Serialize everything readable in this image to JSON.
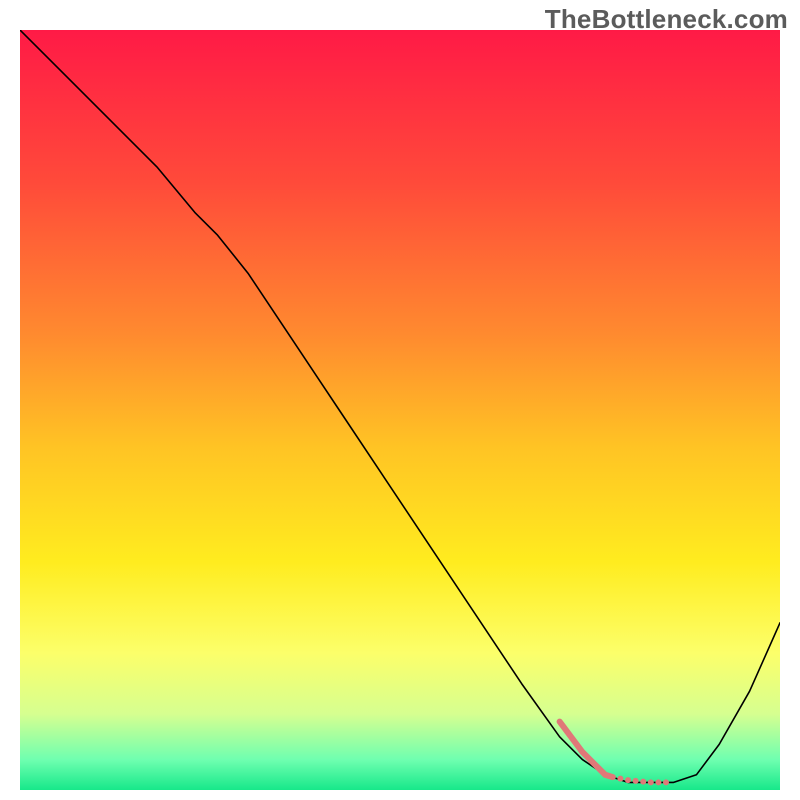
{
  "watermark": "TheBottleneck.com",
  "chart_data": {
    "type": "line",
    "title": "",
    "xlabel": "",
    "ylabel": "",
    "xlim": [
      0,
      100
    ],
    "ylim": [
      0,
      100
    ],
    "grid": false,
    "legend": false,
    "background": {
      "type": "vertical-gradient",
      "stops": [
        {
          "pos": 0.0,
          "color": "#ff1a46"
        },
        {
          "pos": 0.2,
          "color": "#ff4a3a"
        },
        {
          "pos": 0.4,
          "color": "#ff8a2f"
        },
        {
          "pos": 0.55,
          "color": "#ffc424"
        },
        {
          "pos": 0.7,
          "color": "#ffec1f"
        },
        {
          "pos": 0.82,
          "color": "#fcff6a"
        },
        {
          "pos": 0.9,
          "color": "#d6ff90"
        },
        {
          "pos": 0.96,
          "color": "#6fffb0"
        },
        {
          "pos": 1.0,
          "color": "#17e88a"
        }
      ]
    },
    "series": [
      {
        "name": "bottleneck-curve",
        "color": "#000000",
        "width": 1.6,
        "x": [
          0,
          6,
          12,
          18,
          23,
          26,
          30,
          36,
          42,
          48,
          54,
          60,
          66,
          71,
          74,
          77,
          80,
          83,
          86,
          89,
          92,
          96,
          100
        ],
        "y": [
          100,
          94,
          88,
          82,
          76,
          73,
          68,
          59,
          50,
          41,
          32,
          23,
          14,
          7,
          4,
          2,
          1,
          1,
          1,
          2,
          6,
          13,
          22
        ]
      },
      {
        "name": "highlight-segment",
        "color": "#e07878",
        "width": 6,
        "style": "segmented",
        "x": [
          71,
          74,
          77,
          78,
          79,
          80,
          81,
          82,
          83,
          84,
          85
        ],
        "y": [
          9,
          5,
          2,
          1.7,
          1.5,
          1.3,
          1.2,
          1.1,
          1.0,
          1.0,
          1.0
        ]
      }
    ],
    "annotations": []
  }
}
